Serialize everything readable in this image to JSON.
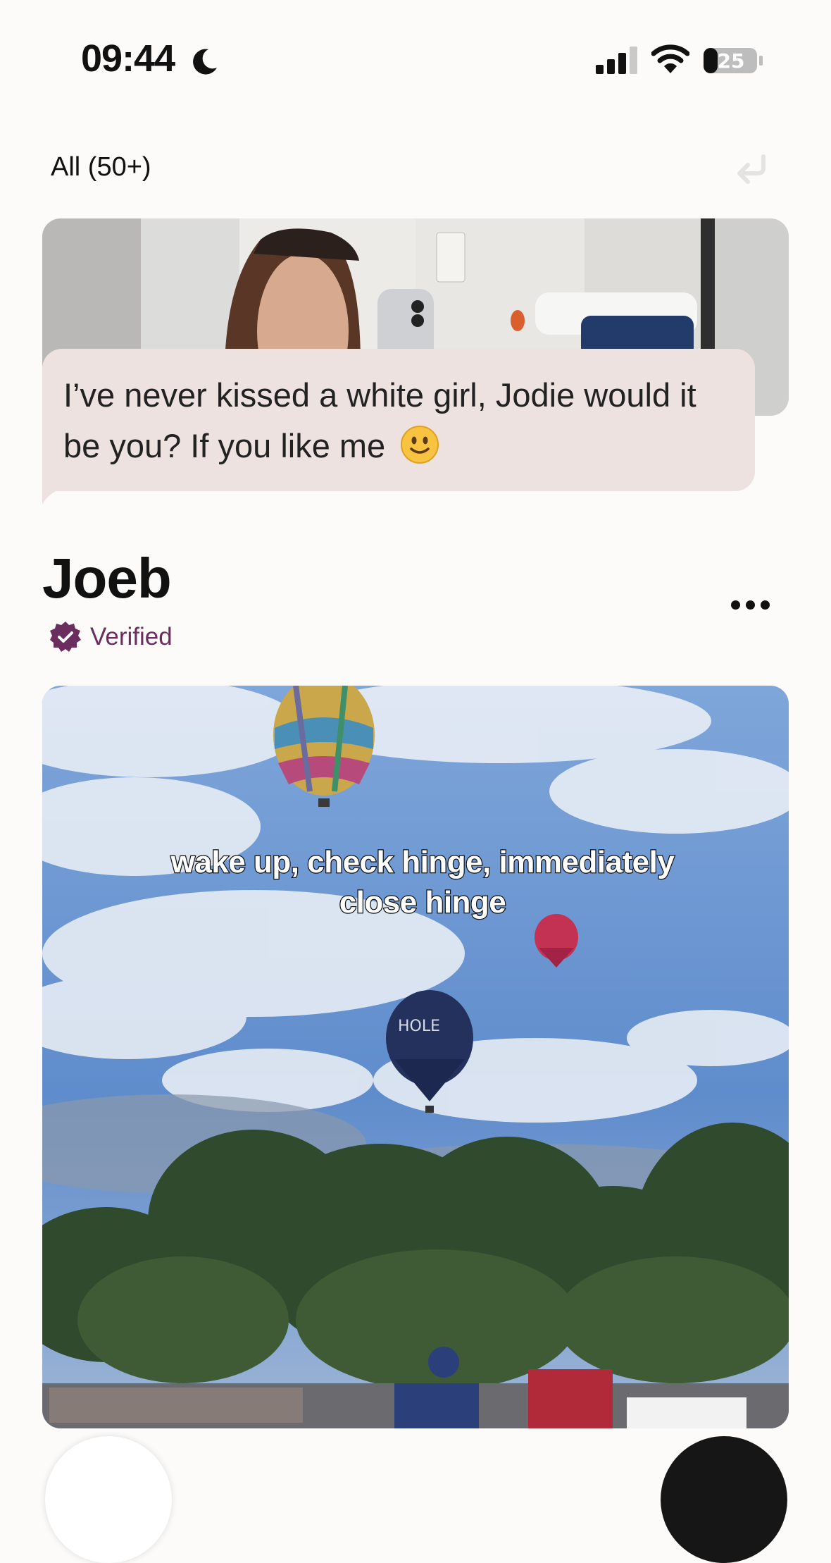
{
  "status_bar": {
    "time": "09:44",
    "battery": "25",
    "icons": [
      "moon-icon",
      "cellular-signal-icon",
      "wifi-icon",
      "battery-icon"
    ]
  },
  "header": {
    "filter_label": "All (50+)",
    "undo_icon": "undo-icon"
  },
  "liked_photo": {
    "comment": "I’ve never kissed a white girl, Jodie would it be you? If you like me",
    "emoji": "slightly-smiling-face-emoji"
  },
  "profile": {
    "name": "Joeb",
    "verified_label": "Verified",
    "more_icon": "more-options-icon"
  },
  "media": {
    "caption_line1": "wake up, check hinge, immediately",
    "caption_line2": "close hinge",
    "balloon_text": "HOLE"
  },
  "colors": {
    "background": "#fcfbfa",
    "bubble": "#ede2df",
    "verified": "#6b2c5e"
  }
}
